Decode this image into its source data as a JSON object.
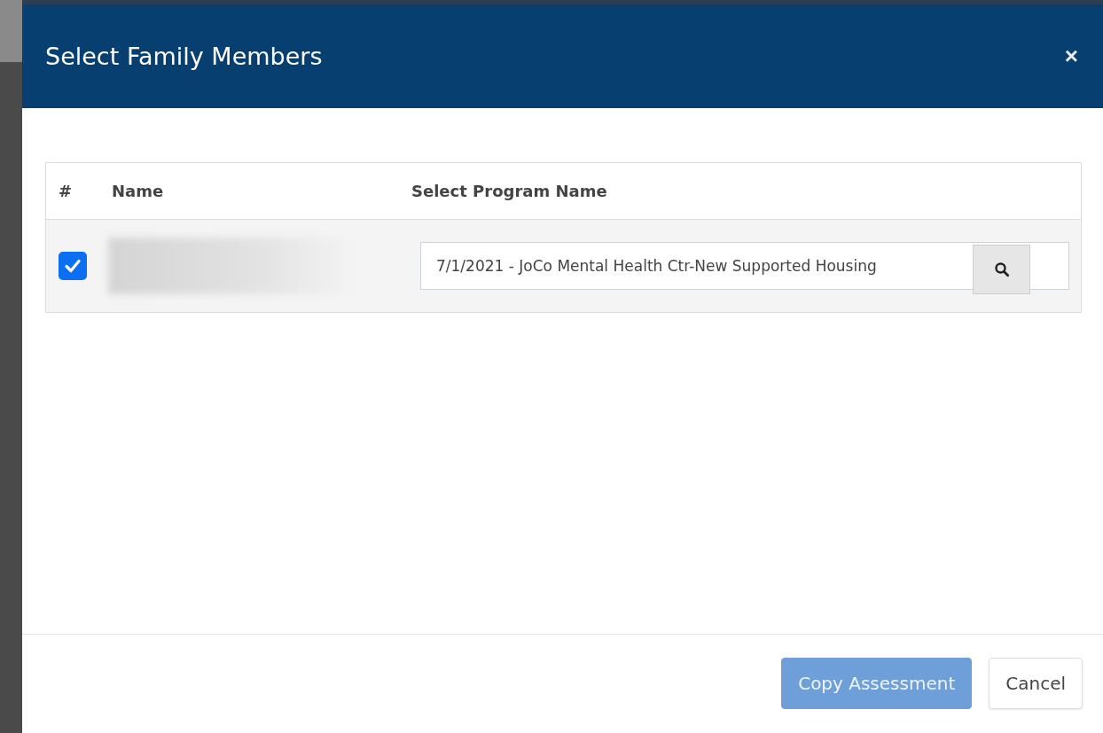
{
  "dialog": {
    "title": "Select Family Members",
    "close": "×"
  },
  "table": {
    "columns": [
      "#",
      "Name",
      "Select Program Name"
    ],
    "rows": [
      {
        "checked": true,
        "program": "7/1/2021 - JoCo Mental Health Ctr-New Supported Housing"
      }
    ]
  },
  "buttons": [
    {
      "label": "Copy Assessment",
      "kind": "primary",
      "disabled": true
    },
    {
      "label": "Cancel",
      "kind": "secondary",
      "disabled": false
    }
  ]
}
